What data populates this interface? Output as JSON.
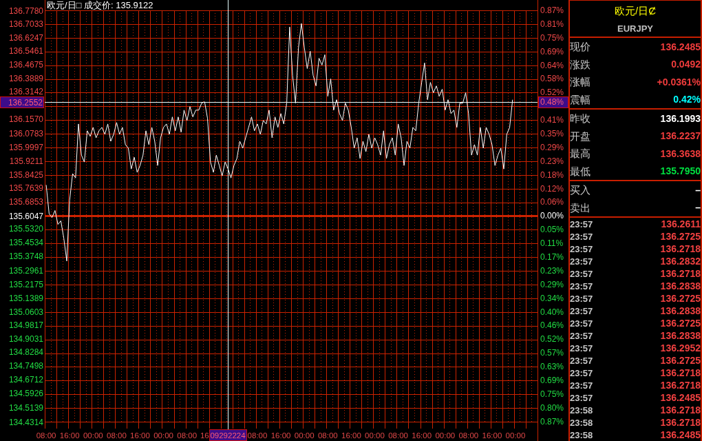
{
  "chart": {
    "chart_data": {
      "type": "line",
      "title": "欧元/日□ 成交价: 135.9122",
      "grid": true,
      "ylim": [
        134.4314,
        136.778
      ],
      "categories": [
        "08:00",
        null,
        null,
        null,
        null,
        null,
        null,
        null,
        "16:00",
        null,
        null,
        null,
        null,
        null,
        null,
        null,
        "00:00",
        null,
        null,
        null,
        null,
        null,
        null,
        null,
        "08:00",
        null,
        null,
        null,
        null,
        null,
        null,
        null,
        "16:00",
        null,
        null,
        null,
        null,
        null,
        null,
        null,
        "00:00",
        null,
        null,
        null,
        null,
        null,
        null,
        null,
        "08:00",
        null,
        null,
        null,
        null,
        null,
        "16",
        null,
        null,
        null,
        null,
        null,
        null,
        null,
        null,
        null,
        null,
        null,
        null,
        null,
        null,
        null,
        null,
        null,
        "08:00",
        null,
        null,
        null,
        null,
        null,
        null,
        null,
        "16:00",
        null,
        null,
        null,
        null,
        null,
        null,
        null,
        "00:00",
        null,
        null,
        null,
        null,
        null,
        null,
        null,
        "08:00",
        null,
        null,
        null,
        null,
        null,
        null,
        null,
        "16:00",
        null,
        null,
        null,
        null,
        null,
        null,
        null,
        "00:00",
        null,
        null,
        null,
        null,
        null,
        null,
        null,
        "08:00",
        null,
        null,
        null,
        null,
        null,
        null,
        null,
        "16:00",
        null,
        null,
        null,
        null,
        null,
        null,
        null,
        "00:00",
        null,
        null,
        null,
        null,
        null,
        null,
        null,
        "08:00",
        null,
        null,
        null,
        null,
        null,
        null,
        null,
        "16:00",
        null,
        null,
        null,
        null,
        null,
        null,
        null,
        "00:00",
        null,
        null,
        null,
        null,
        null,
        null,
        null
      ],
      "yticks": [
        {
          "value": 136.778,
          "label": "136.7780"
        },
        {
          "value": 136.7033,
          "label": "136.7033"
        },
        {
          "value": 136.6247,
          "label": "136.6247"
        },
        {
          "value": 136.5461,
          "label": "136.5461"
        },
        {
          "value": 136.4675,
          "label": "136.4675"
        },
        {
          "value": 136.3889,
          "label": "136.3889"
        },
        {
          "value": 136.3142,
          "label": "136.3142"
        },
        {
          "value": 136.157,
          "label": "136.1570"
        },
        {
          "value": 136.0783,
          "label": "136.0783"
        },
        {
          "value": 135.9997,
          "label": "135.9997"
        },
        {
          "value": 135.9211,
          "label": "135.9211"
        },
        {
          "value": 135.8425,
          "label": "135.8425"
        },
        {
          "value": 135.7639,
          "label": "135.7639"
        },
        {
          "value": 135.6853,
          "label": "135.6853"
        },
        {
          "value": 135.6047,
          "label": "135.6047"
        },
        {
          "value": 135.532,
          "label": "135.5320"
        },
        {
          "value": 135.4534,
          "label": "135.4534"
        },
        {
          "value": 135.3748,
          "label": "135.3748"
        },
        {
          "value": 135.2961,
          "label": "135.2961"
        },
        {
          "value": 135.2175,
          "label": "135.2175"
        },
        {
          "value": 135.1389,
          "label": "135.1389"
        },
        {
          "value": 135.0603,
          "label": "135.0603"
        },
        {
          "value": 134.9817,
          "label": "134.9817"
        },
        {
          "value": 134.9031,
          "label": "134.9031"
        },
        {
          "value": 134.8284,
          "label": "134.8284"
        },
        {
          "value": 134.7498,
          "label": "134.7498"
        },
        {
          "value": 134.6712,
          "label": "134.6712"
        },
        {
          "value": 134.5926,
          "label": "134.5926"
        },
        {
          "value": 134.5139,
          "label": "134.5139"
        },
        {
          "value": 134.4314,
          "label": "134.4314"
        }
      ],
      "series": [
        {
          "color": "#ffffff",
          "values": [
            135.782,
            135.617,
            135.597,
            135.636,
            135.557,
            135.577,
            135.478,
            135.348,
            135.696,
            135.846,
            135.822,
            136.13,
            135.952,
            135.913,
            136.091,
            136.059,
            136.11,
            136.051,
            136.091,
            136.11,
            136.071,
            136.13,
            136.031,
            136.071,
            136.138,
            136.071,
            136.11,
            136.012,
            135.992,
            135.873,
            135.94,
            135.854,
            135.893,
            135.952,
            136.091,
            136.012,
            136.11,
            136.031,
            135.893,
            136.051,
            136.11,
            136.13,
            136.071,
            136.17,
            136.091,
            136.17,
            136.083,
            136.209,
            136.15,
            136.229,
            136.17,
            136.209,
            136.209,
            136.249,
            136.256,
            136.162,
            135.913,
            135.854,
            135.952,
            135.893,
            135.834,
            135.913,
            135.873,
            135.822,
            135.893,
            135.933,
            136.031,
            135.992,
            136.051,
            136.11,
            136.17,
            136.091,
            136.13,
            136.071,
            136.15,
            136.13,
            136.209,
            136.051,
            136.17,
            136.11,
            136.189,
            136.13,
            136.249,
            136.683,
            136.407,
            136.249,
            136.565,
            136.703,
            136.565,
            136.446,
            136.545,
            136.407,
            136.347,
            136.505,
            136.466,
            136.525,
            136.288,
            136.387,
            136.209,
            136.268,
            136.189,
            136.15,
            136.249,
            136.209,
            136.11,
            135.992,
            136.051,
            135.933,
            136.031,
            135.972,
            136.071,
            135.992,
            136.051,
            136.012,
            135.952,
            136.091,
            135.933,
            136.012,
            136.051,
            135.952,
            136.13,
            136.051,
            135.893,
            136.031,
            135.992,
            136.11,
            136.091,
            136.249,
            136.367,
            136.478,
            136.268,
            136.367,
            136.308,
            136.347,
            136.288,
            136.328,
            136.209,
            136.268,
            136.189,
            136.209,
            136.11,
            136.249,
            136.249,
            136.308,
            136.189,
            135.952,
            136.012,
            135.952,
            136.11,
            135.992,
            136.11,
            136.071,
            136.012,
            135.893,
            135.952,
            135.992,
            135.873,
            136.071,
            136.11,
            136.268,
            null,
            null,
            null,
            null,
            null,
            null,
            null,
            null
          ]
        }
      ],
      "ref_lines": [
        {
          "axis": "y",
          "value": 135.6047,
          "color": "#cc2200"
        },
        {
          "axis": "y",
          "value": 136.2552,
          "label": "136.2552",
          "color": "#e8ffff"
        }
      ]
    },
    "cursor_time": "09292224",
    "percent_axis": [
      {
        "label": "0.87%",
        "kind": "up"
      },
      {
        "label": "0.81%",
        "kind": "up"
      },
      {
        "label": "0.75%",
        "kind": "up"
      },
      {
        "label": "0.69%",
        "kind": "up"
      },
      {
        "label": "0.64%",
        "kind": "up"
      },
      {
        "label": "0.58%",
        "kind": "up"
      },
      {
        "label": "0.52%",
        "kind": "up"
      },
      {
        "label": "0.48%",
        "kind": "cursor"
      },
      {
        "label": "0.41%",
        "kind": "up"
      },
      {
        "label": "0.35%",
        "kind": "up"
      },
      {
        "label": "0.29%",
        "kind": "up"
      },
      {
        "label": "0.23%",
        "kind": "up"
      },
      {
        "label": "0.18%",
        "kind": "up"
      },
      {
        "label": "0.12%",
        "kind": "up"
      },
      {
        "label": "0.06%",
        "kind": "up"
      },
      {
        "label": "0.00%",
        "kind": "flat"
      },
      {
        "label": "0.05%",
        "kind": "down"
      },
      {
        "label": "0.11%",
        "kind": "down"
      },
      {
        "label": "0.17%",
        "kind": "down"
      },
      {
        "label": "0.23%",
        "kind": "down"
      },
      {
        "label": "0.29%",
        "kind": "down"
      },
      {
        "label": "0.34%",
        "kind": "down"
      },
      {
        "label": "0.40%",
        "kind": "down"
      },
      {
        "label": "0.46%",
        "kind": "down"
      },
      {
        "label": "0.52%",
        "kind": "down"
      },
      {
        "label": "0.57%",
        "kind": "down"
      },
      {
        "label": "0.63%",
        "kind": "down"
      },
      {
        "label": "0.69%",
        "kind": "down"
      },
      {
        "label": "0.75%",
        "kind": "down"
      },
      {
        "label": "0.80%",
        "kind": "down"
      },
      {
        "label": "0.87%",
        "kind": "down"
      }
    ]
  },
  "quote_panel": {
    "title": "欧元/日Ȼ",
    "code": "EURJPY",
    "groups": [
      {
        "items": [
          {
            "label": "现价",
            "value": "136.2485",
            "color": "#f03c3c"
          },
          {
            "label": "涨跌",
            "value": "0.0492",
            "color": "#f03c3c"
          },
          {
            "label": "涨幅",
            "value": "+0.0361%",
            "color": "#f03c3c"
          },
          {
            "label": "震幅",
            "value": "0.42%",
            "color": "#00ffff"
          }
        ]
      },
      {
        "items": [
          {
            "label": "昨收",
            "value": "136.1993",
            "color": "#ffffff"
          },
          {
            "label": "开盘",
            "value": "136.2237",
            "color": "#f03c3c"
          },
          {
            "label": "最高",
            "value": "136.3638",
            "color": "#f03c3c"
          },
          {
            "label": "最低",
            "value": "135.7950",
            "color": "#00e040"
          }
        ]
      },
      {
        "items": [
          {
            "label": "买入",
            "value": "–",
            "color": "#ffffff"
          },
          {
            "label": "卖出",
            "value": "–",
            "color": "#ffffff"
          }
        ]
      }
    ],
    "ticks": [
      {
        "time": "23:57",
        "price": "136.2611"
      },
      {
        "time": "23:57",
        "price": "136.2725"
      },
      {
        "time": "23:57",
        "price": "136.2718"
      },
      {
        "time": "23:57",
        "price": "136.2832"
      },
      {
        "time": "23:57",
        "price": "136.2718"
      },
      {
        "time": "23:57",
        "price": "136.2838"
      },
      {
        "time": "23:57",
        "price": "136.2725"
      },
      {
        "time": "23:57",
        "price": "136.2838"
      },
      {
        "time": "23:57",
        "price": "136.2725"
      },
      {
        "time": "23:57",
        "price": "136.2838"
      },
      {
        "time": "23:57",
        "price": "136.2952"
      },
      {
        "time": "23:57",
        "price": "136.2725"
      },
      {
        "time": "23:57",
        "price": "136.2718"
      },
      {
        "time": "23:57",
        "price": "136.2718"
      },
      {
        "time": "23:57",
        "price": "136.2485"
      },
      {
        "time": "23:58",
        "price": "136.2718"
      },
      {
        "time": "23:58",
        "price": "136.2718"
      },
      {
        "time": "23:58",
        "price": "136.2485"
      }
    ]
  }
}
